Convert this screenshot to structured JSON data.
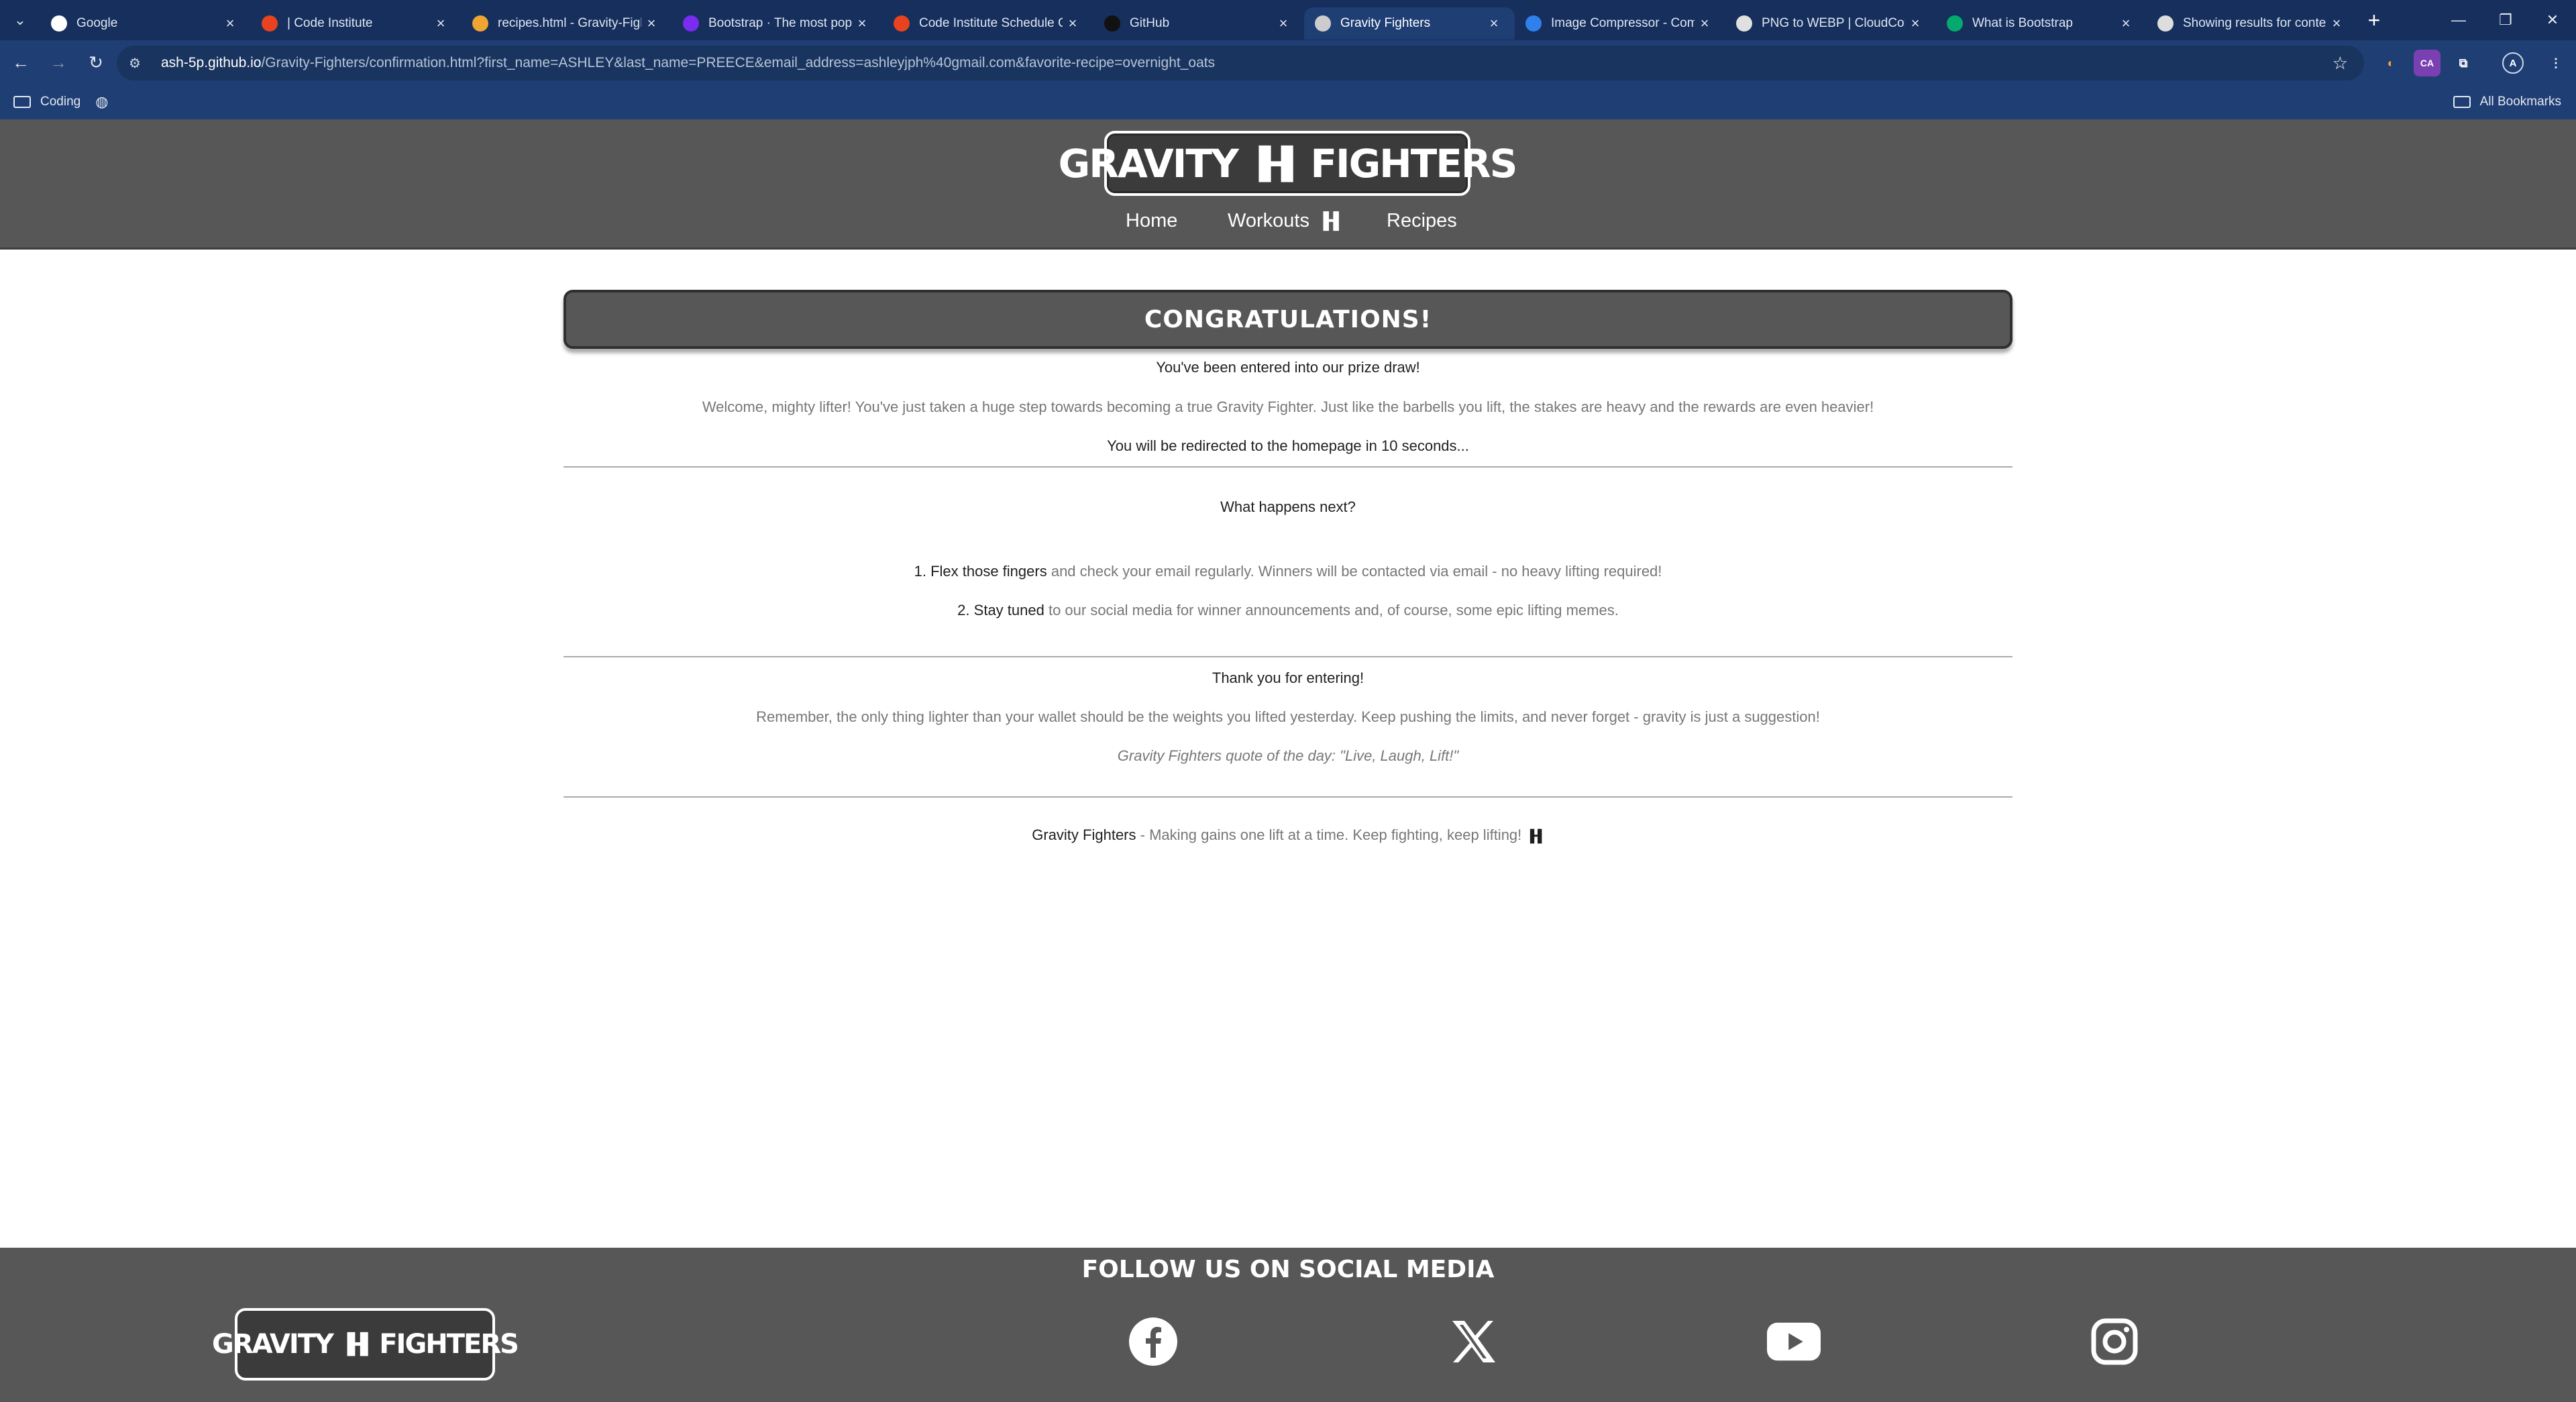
{
  "browser": {
    "tabs": [
      {
        "title": "Google",
        "icon": "google-icon",
        "color": "#ffffff"
      },
      {
        "title": "| Code Institute",
        "icon": "code-institute-icon",
        "color": "#e8431f"
      },
      {
        "title": "recipes.html - Gravity-Figl",
        "icon": "recipes-icon",
        "color": "#f0a431"
      },
      {
        "title": "Bootstrap · The most popu",
        "icon": "bootstrap-icon",
        "color": "#7a2cf0"
      },
      {
        "title": "Code Institute Schedule G",
        "icon": "code-institute-icon",
        "color": "#e8431f"
      },
      {
        "title": "GitHub",
        "icon": "github-icon",
        "color": "#111111"
      },
      {
        "title": "Gravity Fighters",
        "icon": "gravity-fighters-icon",
        "color": "#cccccc"
      },
      {
        "title": "Image Compressor - Com",
        "icon": "image-compressor-icon",
        "color": "#2f80ed"
      },
      {
        "title": "PNG to WEBP | CloudCon",
        "icon": "cloudconvert-icon",
        "color": "#e0e0e0"
      },
      {
        "title": "What is Bootstrap",
        "icon": "w3schools-icon",
        "color": "#04aa6d"
      },
      {
        "title": "Showing results for conte",
        "icon": "search-icon",
        "color": "#dddddd"
      }
    ],
    "active_tab_index": 6,
    "url_host": "ash-5p.github.io",
    "url_path": "/Gravity-Fighters/confirmation.html?first_name=ASHLEY&last_name=PREECE&email_address=ashleyjph%40gmail.com&favorite-recipe=overnight_oats",
    "bookmarks": {
      "folder": "Coding",
      "all_bookmarks": "All Bookmarks"
    },
    "profile_initial": "A"
  },
  "site": {
    "logo_left": "GRAVITY",
    "logo_right": "FIGHTERS",
    "nav": {
      "home": "Home",
      "workouts": "Workouts",
      "recipes": "Recipes"
    }
  },
  "main": {
    "banner": "CONGRATULATIONS!",
    "entered": "You've been entered into our prize draw!",
    "welcome": "Welcome, mighty lifter! You've just taken a huge step towards becoming a true Gravity Fighter. Just like the barbells you lift, the stakes are heavy and the rewards are even heavier!",
    "redirect": "You will be redirected to the homepage in 10 seconds...",
    "next_heading": "What happens next?",
    "steps": [
      {
        "num": "1.",
        "bold": "Flex those fingers",
        "rest": " and check your email regularly. Winners will be contacted via email - no heavy lifting required!"
      },
      {
        "num": "2.",
        "bold": "Stay tuned",
        "rest": " to our social media for winner announcements and, of course, some epic lifting memes."
      }
    ],
    "thanks": "Thank you for entering!",
    "remember": "Remember, the only thing lighter than your wallet should be the weights you lifted yesterday. Keep pushing the limits, and never forget - gravity is just a suggestion!",
    "quote": "Gravity Fighters quote of the day: \"Live, Laugh, Lift!\"",
    "tagline_bold": "Gravity Fighters",
    "tagline_rest": " - Making gains one lift at a time. Keep fighting, keep lifting!"
  },
  "footer": {
    "title": "FOLLOW US ON SOCIAL MEDIA",
    "logo_left": "GRAVITY",
    "logo_right": "FIGHTERS",
    "socials": [
      "facebook-icon",
      "x-icon",
      "youtube-icon",
      "instagram-icon"
    ]
  }
}
